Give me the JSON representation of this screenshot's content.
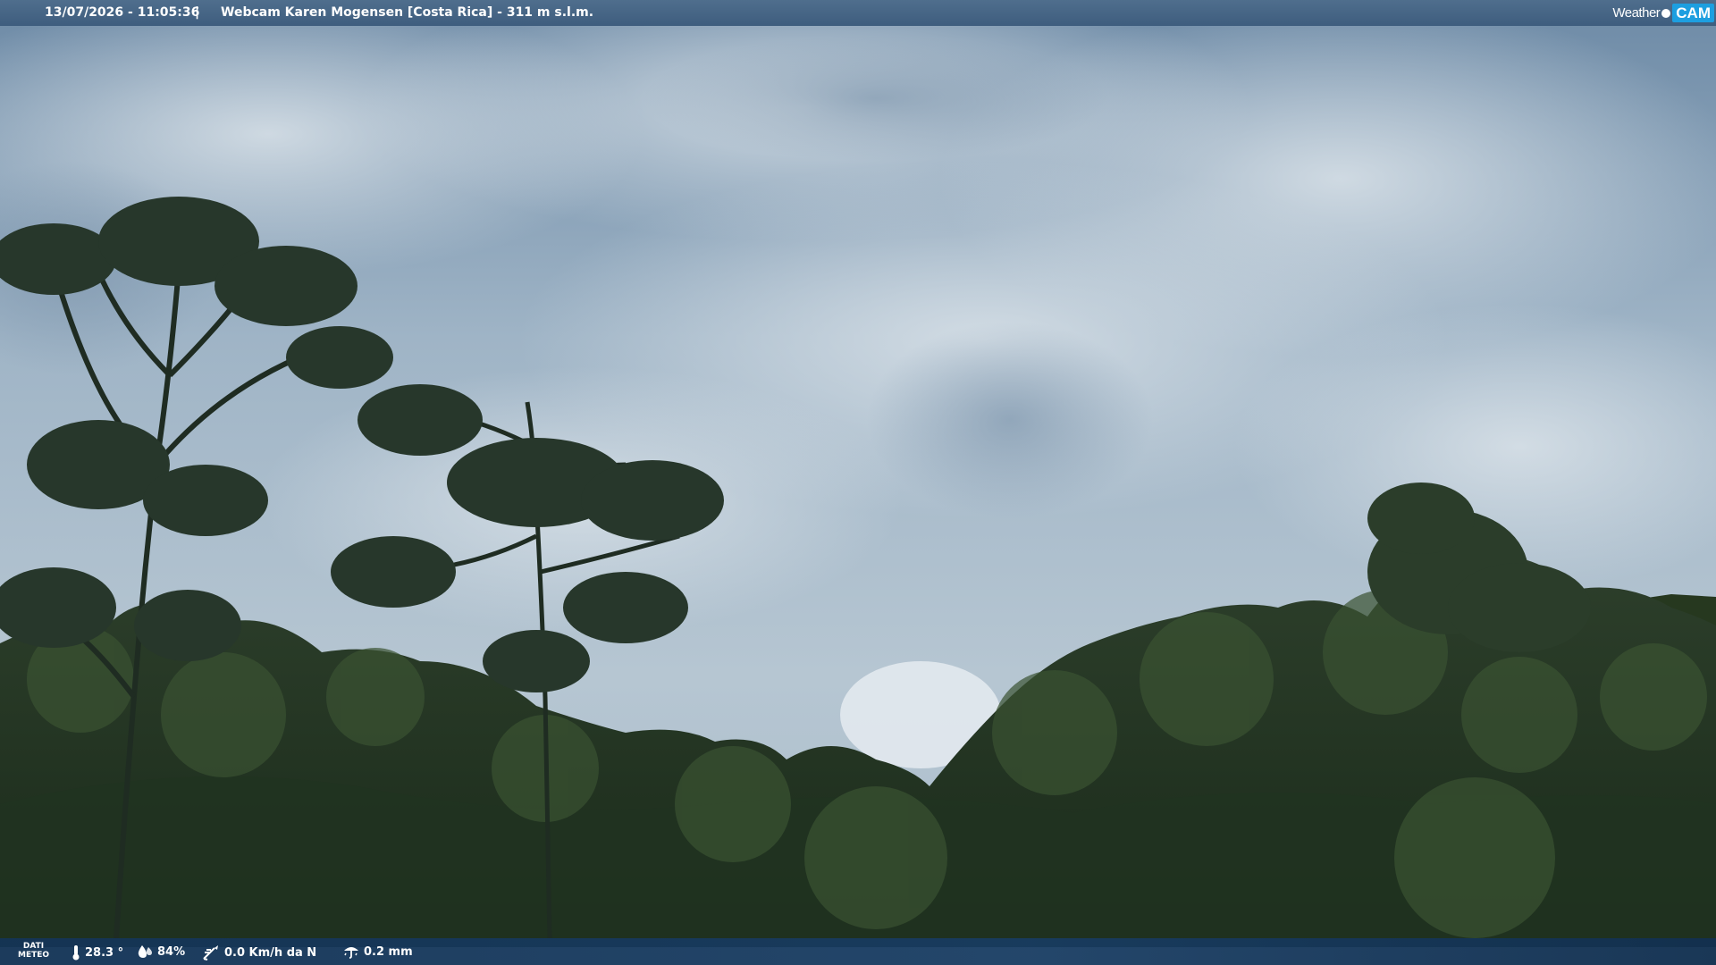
{
  "header": {
    "datetime": "13/07/2026 - 11:05:36",
    "separator": "|",
    "title": "Webcam Karen Mogensen [Costa Rica] - 311 m s.l.m.",
    "logo_word": "Weather",
    "logo_cam": "CAM"
  },
  "footer": {
    "meteo_label_line1": "DATI",
    "meteo_label_line2": "METEO",
    "temperature": "28.3 °",
    "humidity": "84%",
    "wind": "0.0 Km/h da N",
    "rain": "0.2 mm",
    "icons": [
      "thermometer-icon",
      "humidity-drop-icon",
      "wind-vane-icon",
      "rain-gauge-icon"
    ]
  },
  "colors": {
    "topbar": "#466688",
    "bottombar": "#163a60",
    "logo_accent": "#1d9fe0"
  }
}
